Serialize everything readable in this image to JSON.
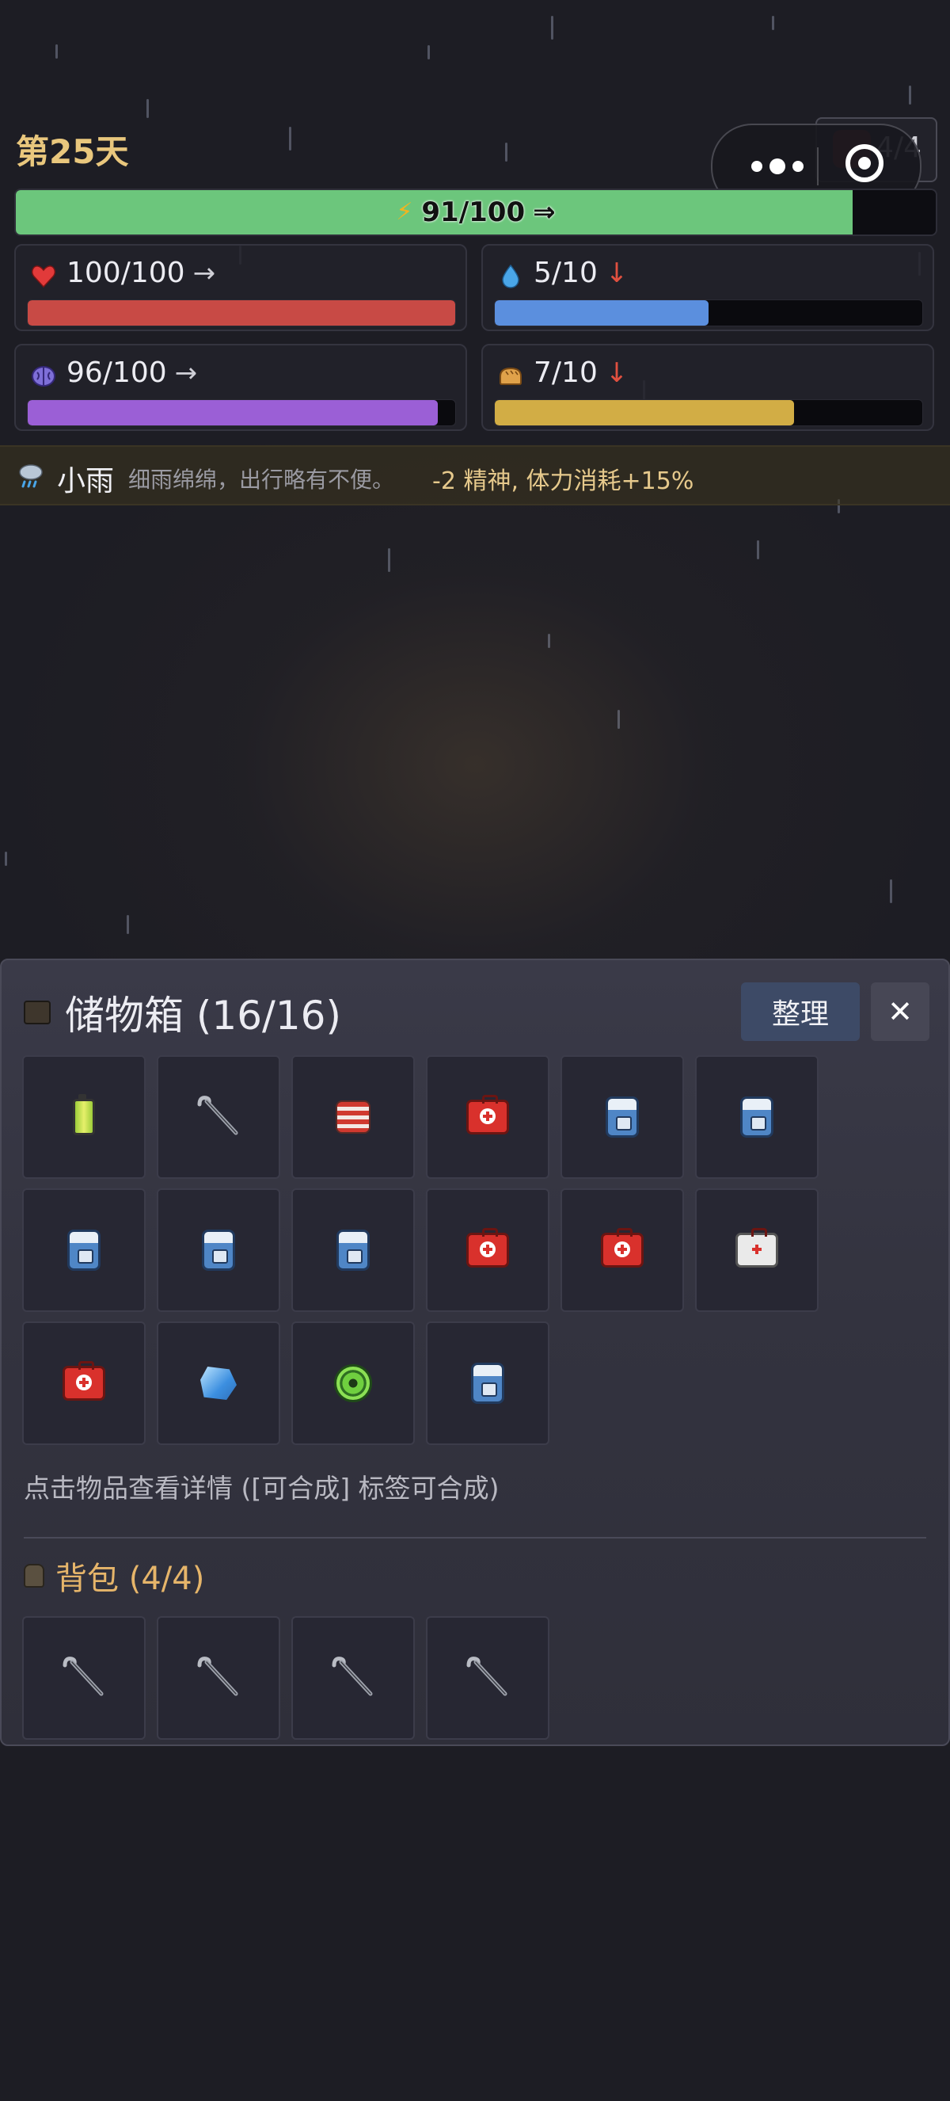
{
  "header": {
    "day": "第25天",
    "bag_count": "4/4"
  },
  "energy": {
    "text": "91/100",
    "arrow": "⇒",
    "fill_fraction": 0.91,
    "color": "#6cc67c"
  },
  "stats": [
    {
      "name": "health",
      "icon": "heart-icon",
      "value": "100/100",
      "trend": "→",
      "trend_color": "#cfcfd6",
      "fill_fraction": 1.0,
      "color": "#c84a45"
    },
    {
      "name": "water",
      "icon": "water-drop-icon",
      "value": "5/10",
      "trend": "↓",
      "trend_color": "#e05040",
      "fill_fraction": 0.5,
      "color": "#5b8fde"
    },
    {
      "name": "spirit",
      "icon": "brain-icon",
      "value": "96/100",
      "trend": "→",
      "trend_color": "#cfcfd6",
      "fill_fraction": 0.96,
      "color": "#9b5fd6"
    },
    {
      "name": "food",
      "icon": "bread-icon",
      "value": "7/10",
      "trend": "↓",
      "trend_color": "#e05040",
      "fill_fraction": 0.7,
      "color": "#d2ad45"
    }
  ],
  "weather": {
    "icon": "rain-cloud-icon",
    "name": "小雨",
    "description": "细雨绵绵，出行略有不便。",
    "effect": "-2 精神, 体力消耗+15%"
  },
  "storage": {
    "title": "储物箱 (16/16)",
    "sort_label": "整理",
    "close_label": "✕",
    "items": [
      "battery-icon",
      "crowbar-icon",
      "duct-tape-icon",
      "first-aid-kit-icon",
      "backpack-icon",
      "backpack-icon",
      "backpack-icon",
      "backpack-icon",
      "backpack-icon",
      "first-aid-kit-icon",
      "first-aid-kit-icon",
      "white-medkit-icon",
      "first-aid-kit-icon",
      "blue-crystal-icon",
      "green-reel-icon",
      "backpack-icon"
    ],
    "hint": "点击物品查看详情 ([可合成] 标签可合成)"
  },
  "backpack": {
    "title": "背包 (4/4)",
    "items": [
      "crowbar-icon",
      "crowbar-icon",
      "crowbar-icon",
      "crowbar-icon"
    ]
  }
}
